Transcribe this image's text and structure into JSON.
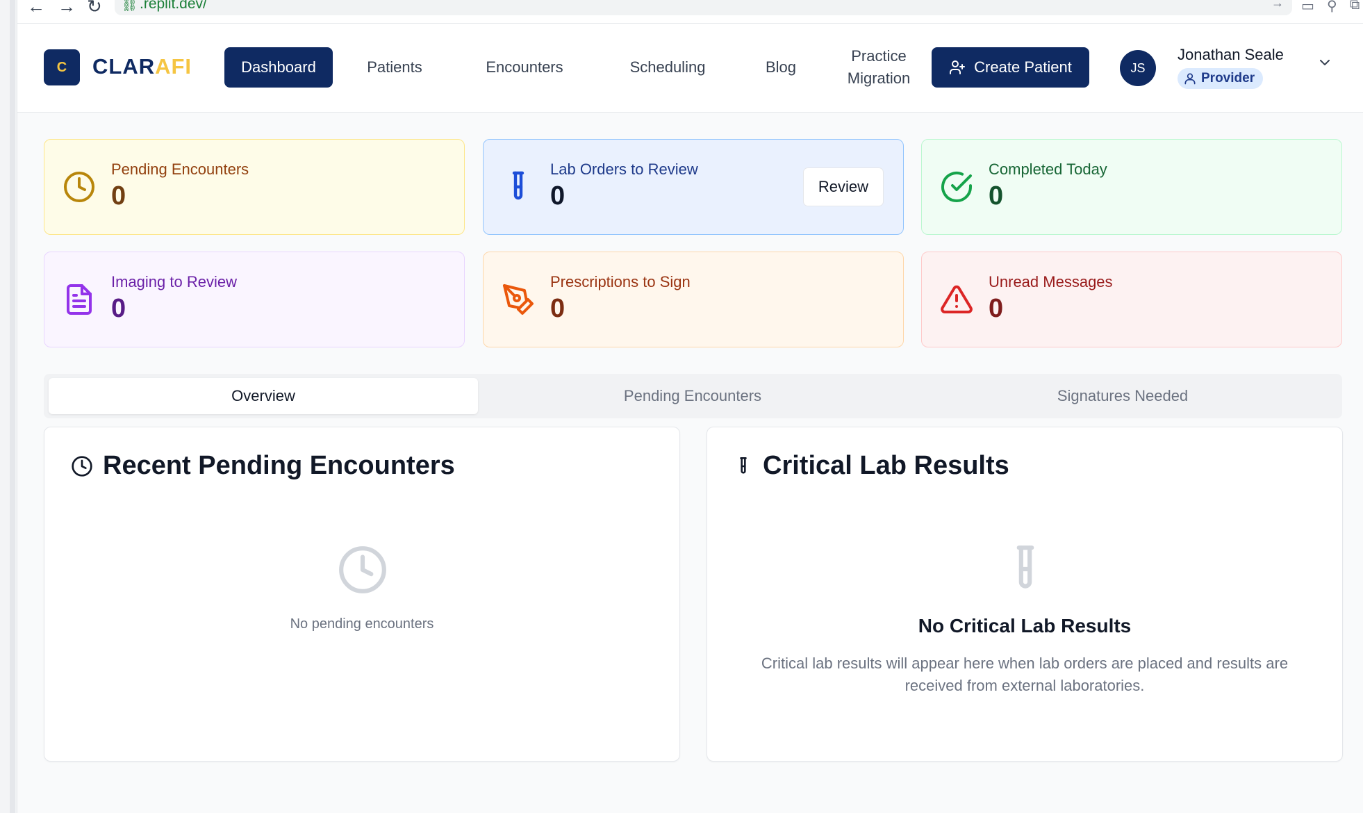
{
  "browser": {
    "url": ".replit.dev/"
  },
  "header": {
    "logo_letter": "C",
    "brand_part1": "CLAR",
    "brand_part2": "AFI",
    "nav": {
      "dashboard": "Dashboard",
      "patients": "Patients",
      "encounters": "Encounters",
      "scheduling": "Scheduling",
      "blog": "Blog",
      "practice_line1": "Practice",
      "practice_line2": "Migration"
    },
    "create_patient": "Create Patient",
    "user": {
      "initials": "JS",
      "name": "Jonathan Seale",
      "role": "Provider"
    }
  },
  "stats": {
    "pending": {
      "label": "Pending Encounters",
      "value": "0",
      "icon": "clock-icon"
    },
    "lab": {
      "label": "Lab Orders to Review",
      "value": "0",
      "icon": "test-tube-icon",
      "action": "Review"
    },
    "completed": {
      "label": "Completed Today",
      "value": "0",
      "icon": "check-circle-icon"
    },
    "imaging": {
      "label": "Imaging to Review",
      "value": "0",
      "icon": "file-text-icon"
    },
    "prescriptions": {
      "label": "Prescriptions to Sign",
      "value": "0",
      "icon": "pen-tool-icon"
    },
    "messages": {
      "label": "Unread Messages",
      "value": "0",
      "icon": "alert-triangle-icon"
    }
  },
  "tabs": {
    "overview": "Overview",
    "pending": "Pending Encounters",
    "signatures": "Signatures Needed"
  },
  "panels": {
    "recent": {
      "title": "Recent Pending Encounters",
      "empty": "No pending encounters"
    },
    "critical": {
      "title": "Critical Lab Results",
      "empty_title": "No Critical Lab Results",
      "empty_line1": "Critical lab results will appear here when lab orders are placed and results are",
      "empty_line2": "received from external laboratories."
    }
  },
  "colors": {
    "brand_navy": "#0f2a62",
    "brand_gold": "#f5c542"
  }
}
